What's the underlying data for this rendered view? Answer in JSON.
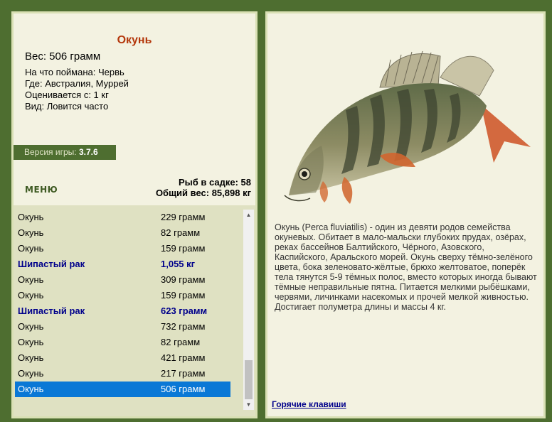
{
  "fish": {
    "title": "Окунь",
    "weight": "Вес: 506 грамм",
    "bait": "На что поймана: Червь",
    "where": "Где: Австралия, Муррей",
    "valued_from": "Оценивается с: 1 кг",
    "frequency": "Вид: Ловится часто"
  },
  "version": {
    "label": "Версия игры: ",
    "value": "3.7.6"
  },
  "menu": {
    "label": "МЕНЮ"
  },
  "stats": {
    "count": "Рыб в садке: 58",
    "total": "Общий вес: 85,898 кг"
  },
  "catch_list": [
    {
      "name": "Окунь",
      "weight": "229 грамм",
      "bold": false,
      "selected": false
    },
    {
      "name": "Окунь",
      "weight": "82 грамм",
      "bold": false,
      "selected": false
    },
    {
      "name": "Окунь",
      "weight": "159 грамм",
      "bold": false,
      "selected": false
    },
    {
      "name": "Шипастый рак",
      "weight": "1,055 кг",
      "bold": true,
      "selected": false
    },
    {
      "name": "Окунь",
      "weight": "309 грамм",
      "bold": false,
      "selected": false
    },
    {
      "name": "Окунь",
      "weight": "159 грамм",
      "bold": false,
      "selected": false
    },
    {
      "name": "Шипастый рак",
      "weight": "623 грамм",
      "bold": true,
      "selected": false
    },
    {
      "name": "Окунь",
      "weight": "732 грамм",
      "bold": false,
      "selected": false
    },
    {
      "name": "Окунь",
      "weight": "82 грамм",
      "bold": false,
      "selected": false
    },
    {
      "name": "Окунь",
      "weight": "421 грамм",
      "bold": false,
      "selected": false
    },
    {
      "name": "Окунь",
      "weight": "217 грамм",
      "bold": false,
      "selected": false
    },
    {
      "name": "Окунь",
      "weight": "506 грамм",
      "bold": false,
      "selected": true
    }
  ],
  "description": "Окунь (Perca fluviatilis) - один из девяти родов семейства окуневых. Обитает в мало-мальски глубоких прудах, озёрах, реках бассейнов Балтийского, Чёрного, Азовского, Каспийского, Аральского морей. Окунь сверху тёмно-зелёного цвета, бока зеленовато-жёлтые, брюхо желтоватое, поперёк тела тянутся 5-9 тёмных полос, вместо которых иногда бывают тёмные неправильные пятна. Питается мелкими рыбёшками, червями, личинками насекомых и прочей мелкой живностью. Достигает полуметра длины и массы 4 кг.",
  "hotkeys": {
    "label": "Горячие клавиши"
  },
  "icons": {
    "scroll_up": "scroll-up-arrow-icon",
    "scroll_down": "scroll-down-arrow-icon"
  },
  "colors": {
    "background": "#4e6e30",
    "panel": "#f3f2e1",
    "title": "#b4380c",
    "highlight": "#0a78d6",
    "link": "#00008b"
  }
}
